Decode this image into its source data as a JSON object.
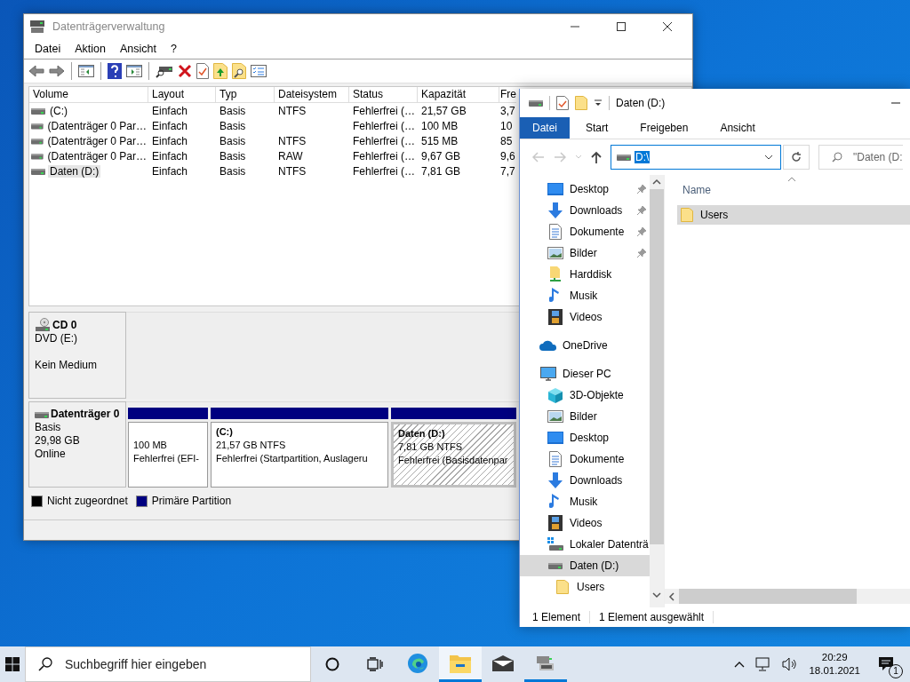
{
  "disk_management": {
    "title": "Datenträgerverwaltung",
    "menu": [
      "Datei",
      "Aktion",
      "Ansicht",
      "?"
    ],
    "columns": [
      "Volume",
      "Layout",
      "Typ",
      "Dateisystem",
      "Status",
      "Kapazität",
      "Fre"
    ],
    "rows": [
      {
        "selected": false,
        "cells": [
          "(C:)",
          "Einfach",
          "Basis",
          "NTFS",
          "Fehlerfrei (…",
          "21,57 GB",
          "3,7"
        ]
      },
      {
        "selected": false,
        "cells": [
          "(Datenträger 0 Par…",
          "Einfach",
          "Basis",
          "",
          "Fehlerfrei (…",
          "100 MB",
          "10"
        ]
      },
      {
        "selected": false,
        "cells": [
          "(Datenträger 0 Par…",
          "Einfach",
          "Basis",
          "NTFS",
          "Fehlerfrei (…",
          "515 MB",
          "85"
        ]
      },
      {
        "selected": false,
        "cells": [
          "(Datenträger 0 Par…",
          "Einfach",
          "Basis",
          "RAW",
          "Fehlerfrei (…",
          "9,67 GB",
          "9,6"
        ]
      },
      {
        "selected": true,
        "cells": [
          "Daten (D:)",
          "Einfach",
          "Basis",
          "NTFS",
          "Fehlerfrei (…",
          "7,81 GB",
          "7,7"
        ]
      }
    ],
    "disks": [
      {
        "kind": "cd",
        "name": "CD 0",
        "type": "DVD (E:)",
        "status": "Kein Medium"
      },
      {
        "kind": "disk",
        "name": "Datenträger 0",
        "type": "Basis",
        "size": "29,98 GB",
        "status": "Online",
        "partitions": [
          {
            "hatched": false,
            "size": "100 MB",
            "status": "Fehlerfrei (EFI-"
          },
          {
            "hatched": false,
            "label": "(C:)",
            "size": "21,57 GB NTFS",
            "status": "Fehlerfrei (Startpartition, Auslageru"
          },
          {
            "hatched": true,
            "label": "Daten  (D:)",
            "size": "7,81 GB NTFS",
            "status": "Fehlerfrei (Basisdatenpar"
          }
        ]
      }
    ],
    "legend": [
      {
        "label": "Nicht zugeordnet",
        "color": "#000000"
      },
      {
        "label": "Primäre Partition",
        "color": "#000080"
      }
    ]
  },
  "explorer": {
    "title": "Daten (D:)",
    "tabs": [
      {
        "label": "Datei",
        "kind": "file"
      },
      {
        "label": "Start",
        "kind": "tab"
      },
      {
        "label": "Freigeben",
        "kind": "tab"
      },
      {
        "label": "Ansicht",
        "kind": "tab"
      }
    ],
    "address": "D:\\",
    "search": {
      "placeholder": "\"Daten (D:"
    },
    "quick_access": [
      {
        "label": "Desktop",
        "kind": "desktop",
        "pinned": true
      },
      {
        "label": "Downloads",
        "kind": "downloads",
        "pinned": true
      },
      {
        "label": "Dokumente",
        "kind": "documents",
        "pinned": true
      },
      {
        "label": "Bilder",
        "kind": "pictures",
        "pinned": true
      },
      {
        "label": "Harddisk",
        "kind": "share",
        "pinned": false
      },
      {
        "label": "Musik",
        "kind": "music",
        "pinned": false
      },
      {
        "label": "Videos",
        "kind": "videos",
        "pinned": false
      }
    ],
    "tree": [
      {
        "label": "OneDrive",
        "kind": "onedrive",
        "selected": false
      },
      {
        "label": "Dieser PC",
        "kind": "pc",
        "selected": false,
        "children": [
          {
            "label": "3D-Objekte",
            "kind": "objects",
            "selected": false
          },
          {
            "label": "Bilder",
            "kind": "pictures",
            "selected": false
          },
          {
            "label": "Desktop",
            "kind": "desktop",
            "selected": false
          },
          {
            "label": "Dokumente",
            "kind": "documents",
            "selected": false
          },
          {
            "label": "Downloads",
            "kind": "downloads",
            "selected": false
          },
          {
            "label": "Musik",
            "kind": "music",
            "selected": false
          },
          {
            "label": "Videos",
            "kind": "videos",
            "selected": false
          },
          {
            "label": "Lokaler Datenträ",
            "kind": "localdisk",
            "selected": false
          },
          {
            "label": "Daten (D:)",
            "kind": "drive",
            "selected": true,
            "children": [
              {
                "label": "Users",
                "kind": "folder",
                "selected": false
              }
            ]
          }
        ]
      }
    ],
    "column": "Name",
    "files": [
      {
        "name": "Users",
        "selected": true
      }
    ],
    "status": [
      "1 Element",
      "1 Element ausgewählt"
    ]
  },
  "taskbar": {
    "search": {
      "placeholder": "Suchbegriff hier eingeben"
    },
    "apps": [
      {
        "kind": "edge",
        "active": false,
        "running": false
      },
      {
        "kind": "explorer",
        "active": true,
        "running": true
      },
      {
        "kind": "mail",
        "active": false,
        "running": false
      },
      {
        "kind": "diskmgmt",
        "active": false,
        "running": true
      }
    ],
    "time": "20:29",
    "date": "18.01.2021",
    "notifications": "1"
  }
}
